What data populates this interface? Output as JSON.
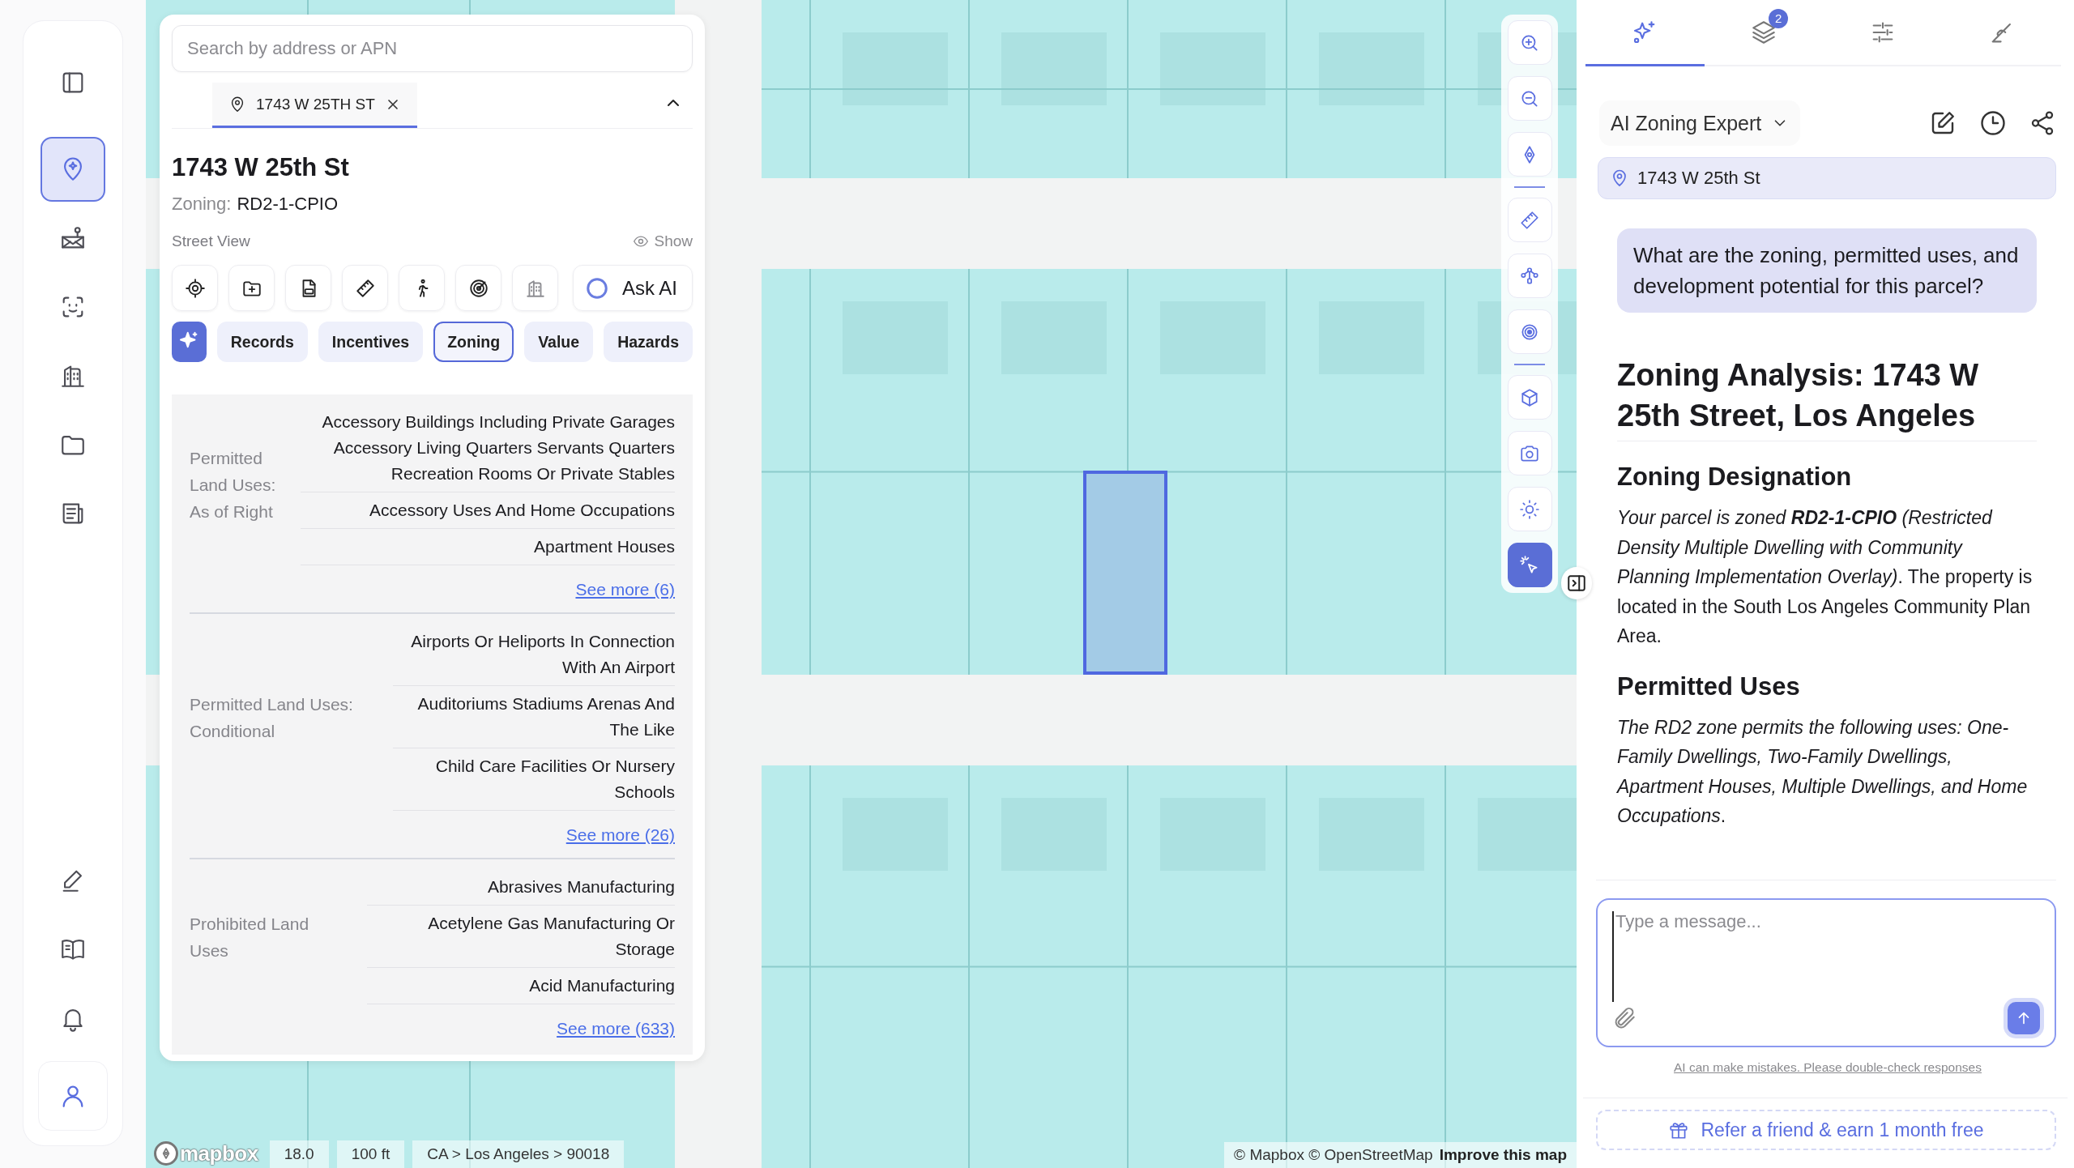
{
  "nav": {
    "items": [
      {
        "selected": false
      },
      {
        "selected": true
      },
      {
        "selected": false
      },
      {
        "selected": false
      },
      {
        "selected": false
      },
      {
        "selected": false
      },
      {
        "selected": false
      }
    ],
    "bottom_items": [
      {
        "selected": false
      },
      {
        "selected": false
      },
      {
        "selected": false
      }
    ]
  },
  "search": {
    "placeholder": "Search by address or APN"
  },
  "property_tabs": [
    {
      "label": "1743 W 25TH ST",
      "selected": true
    }
  ],
  "property": {
    "title": "1743 W 25th St",
    "zoning_label": "Zoning:",
    "zoning_value": "RD2-1-CPIO",
    "street_view_label": "Street View",
    "street_view_toggle": "Show"
  },
  "actions": {
    "ask_ai": "Ask AI"
  },
  "categories": [
    {
      "label": "Records",
      "selected": false
    },
    {
      "label": "Incentives",
      "selected": false
    },
    {
      "label": "Zoning",
      "selected": true
    },
    {
      "label": "Value",
      "selected": false
    },
    {
      "label": "Hazards",
      "selected": false
    }
  ],
  "land_uses": [
    {
      "label": "Permitted Land Uses: As of Right",
      "items": [
        "Accessory Buildings Including Private Garages Accessory Living Quarters Servants Quarters Recreation Rooms Or Private Stables",
        "Accessory Uses And Home Occupations",
        "Apartment Houses"
      ],
      "see_more": "See more (6)"
    },
    {
      "label": "Permitted Land Uses: Conditional",
      "items": [
        "Airports Or Heliports In Connection With An Airport",
        "Auditoriums Stadiums Arenas And The Like",
        "Child Care Facilities Or Nursery Schools"
      ],
      "see_more": "See more (26)"
    },
    {
      "label": "Prohibited Land Uses",
      "items": [
        "Abrasives Manufacturing",
        "Acetylene Gas Manufacturing Or Storage",
        "Acid Manufacturing"
      ],
      "see_more": "See more (633)"
    }
  ],
  "map": {
    "logo": "mapbox",
    "zoom": "18.0",
    "scale": "100 ft",
    "breadcrumb": "CA > Los Angeles > 90018",
    "attribution": "© Mapbox © OpenStreetMap",
    "improve_link": "Improve this map"
  },
  "map_tools": [
    {
      "selected": false
    },
    {
      "selected": false
    },
    {
      "selected": false
    },
    {
      "selected": false
    },
    {
      "selected": false
    },
    {
      "selected": false
    },
    {
      "selected": false
    },
    {
      "selected": false
    },
    {
      "selected": false
    },
    {
      "selected": true
    }
  ],
  "assistant": {
    "tabs": [
      {
        "selected": true
      },
      {
        "selected": false,
        "badge": "2"
      },
      {
        "selected": false
      },
      {
        "selected": false
      }
    ],
    "agent": "AI Zoning Expert",
    "address": "1743 W 25th St",
    "question": "What are the zoning, permitted uses, and development potential for this parcel?",
    "response": [
      {
        "kind": "heading",
        "text": "Zoning Analysis: 1743 W 25th Street, Los Angeles"
      },
      {
        "kind": "subheading",
        "text": "Zoning Designation"
      },
      {
        "kind": "paragraph",
        "text": "*Your parcel is zoned* **RD2-1-CPIO** *(Restricted Density Multiple Dwelling with Community Planning Implementation Overlay)*. The property is located in the South Los Angeles Community Plan Area."
      },
      {
        "kind": "subheading",
        "text": "Permitted Uses"
      },
      {
        "kind": "paragraph",
        "text": "*The RD2 zone permits the following uses: One-Family Dwellings, Two-Family Dwellings, Apartment Houses, Multiple Dwellings, and Home Occupations*."
      }
    ],
    "composer": {
      "placeholder": "Type a message..."
    },
    "disclaimer": "AI can make mistakes. Please double-check responses",
    "referral": "Refer a friend & earn 1 month free"
  }
}
